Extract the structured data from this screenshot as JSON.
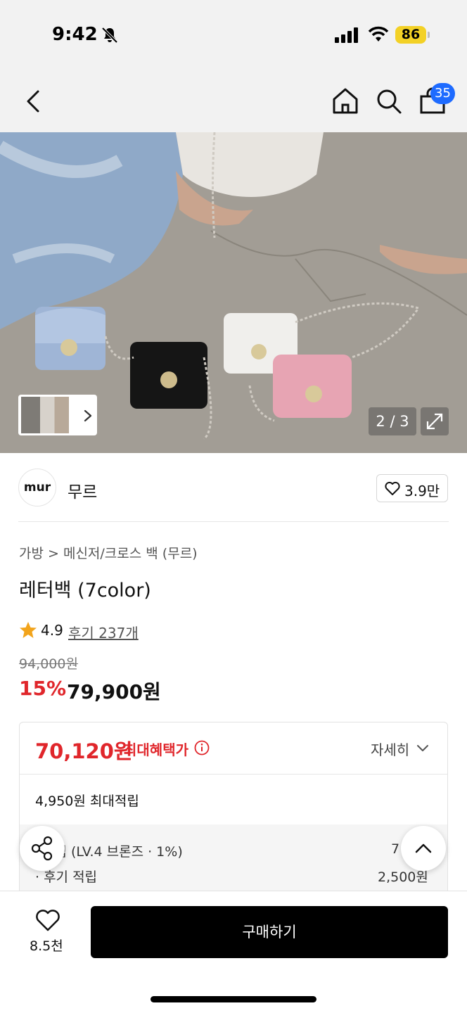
{
  "status_bar": {
    "time": "9:42",
    "battery": "86",
    "icons": [
      "bell-slash-icon",
      "signal-icon",
      "wifi-icon",
      "battery-icon"
    ]
  },
  "nav": {
    "icons": [
      "back-icon",
      "home-icon",
      "search-icon",
      "cart-icon"
    ],
    "cart_badge": "35"
  },
  "hero": {
    "counter": "2 / 3",
    "icons": [
      "chevron-right-icon",
      "expand-icon"
    ]
  },
  "brand": {
    "logo_text": "mur",
    "name": "무르",
    "like_count": "3.9만"
  },
  "product": {
    "breadcrumb": "가방 > 메신저/크로스 백 (무르)",
    "title": "레터백 (7color)",
    "rating": "4.9",
    "review_link": "후기 237개",
    "original_price": "94,000원",
    "discount": "15%",
    "sale_price": "79,900원"
  },
  "benefit": {
    "price": "70,120원",
    "label": "최대혜택가",
    "details": "자세히",
    "max_points": "4,950원 최대적립",
    "rows": [
      {
        "label": "적립 (LV.4 브론즈 · 1%)",
        "value": "7"
      },
      {
        "label": "· 후기 적립",
        "value": "2,500원"
      }
    ]
  },
  "bottom": {
    "wish_count": "8.5천",
    "buy_label": "구매하기"
  },
  "colors": {
    "accent_red": "#e0262b",
    "badge_blue": "#1e6bff",
    "battery_yellow": "#f3d126"
  }
}
